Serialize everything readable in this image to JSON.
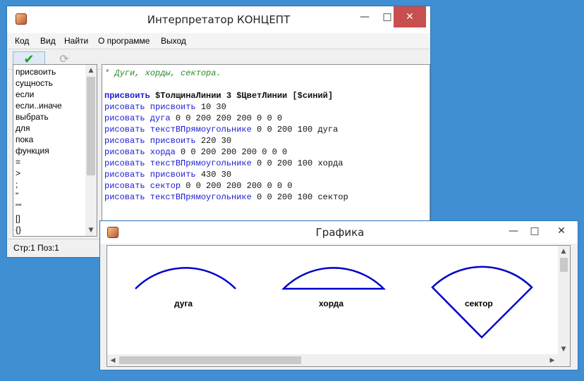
{
  "main_window": {
    "title": "Интерпретатор КОНЦЕПТ",
    "menu": [
      "Код",
      "Вид",
      "Найти",
      "О программе",
      "Выход"
    ],
    "keywords": [
      "присвоить",
      "сущность",
      "если",
      "если..иначе",
      "выбрать",
      "для",
      "пока",
      "функция",
      "=",
      ">",
      ";",
      "\"",
      "\"\"",
      "[]",
      "{}"
    ],
    "code": {
      "comment": "* Дуги, хорды, сектора.",
      "assign_kw": "присвоить",
      "assign_rest": " $ТолщинаЛинии 3 $ЦветЛинии [$синий]",
      "lines": [
        {
          "kw": "рисовать присвоить",
          "rest": " 10 30"
        },
        {
          "kw": "рисовать дуга",
          "rest": " 0 0 200 200 200 0 0 0"
        },
        {
          "kw": "рисовать текстВПрямоугольнике",
          "rest": " 0 0 200 100 дуга"
        },
        {
          "kw": "рисовать присвоить",
          "rest": " 220 30"
        },
        {
          "kw": "рисовать хорда",
          "rest": " 0 0 200 200 200 0 0 0"
        },
        {
          "kw": "рисовать текстВПрямоугольнике",
          "rest": " 0 0 200 100 хорда"
        },
        {
          "kw": "рисовать присвоить",
          "rest": " 430 30"
        },
        {
          "kw": "рисовать сектор",
          "rest": " 0 0 200 200 200 0 0 0"
        },
        {
          "kw": "рисовать текстВПрямоугольнике",
          "rest": " 0 0 200 100 сектор"
        }
      ]
    },
    "status": "Стр:1 Поз:1"
  },
  "graphics_window": {
    "title": "Графика",
    "labels": {
      "arc": "дуга",
      "chord": "хорда",
      "sector": "сектор"
    }
  },
  "icons": {
    "run": "check-icon",
    "refresh": "refresh-icon",
    "minimize": "minimize-icon",
    "maximize": "maximize-icon",
    "close": "close-icon"
  },
  "colors": {
    "keyword": "#1a1ad6",
    "comment": "#2a8a2a",
    "shape_stroke": "#0000cc",
    "close_button": "#c74f4f",
    "run_check": "#1e9e1e"
  }
}
